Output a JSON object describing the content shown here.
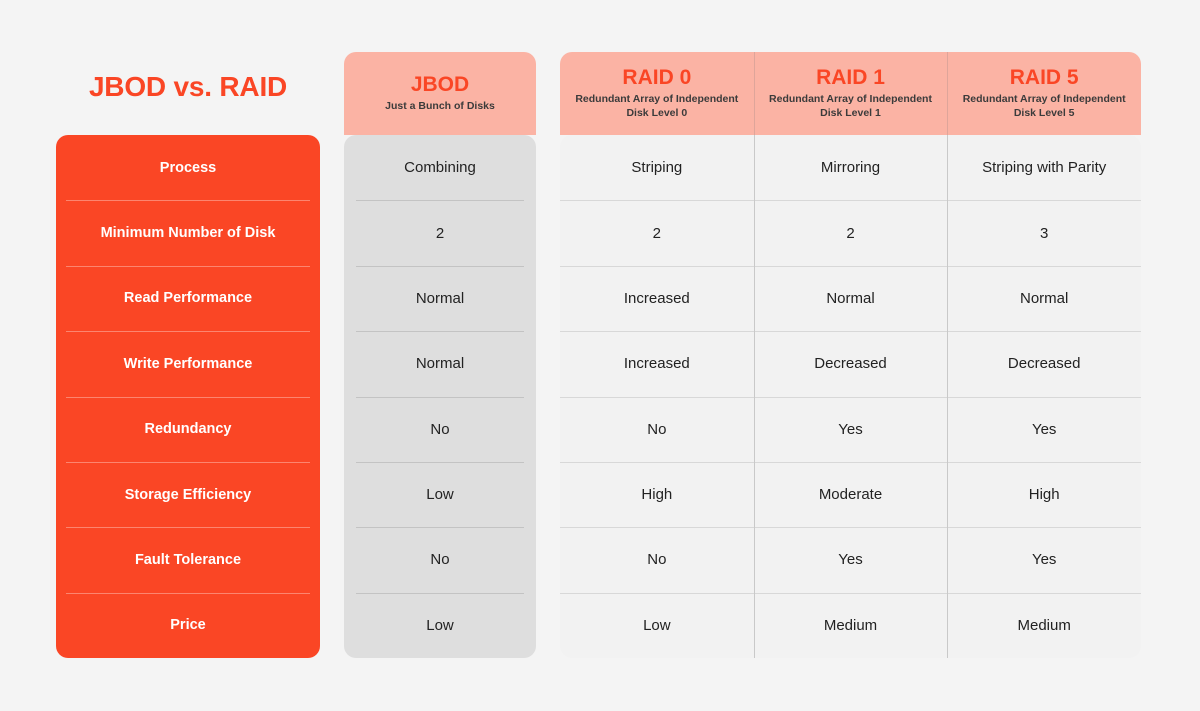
{
  "title": "JBOD vs. RAID",
  "colors": {
    "background": "#f4f4f4",
    "accent_red": "#fa4625",
    "header_pink": "#fbb3a4",
    "jbod_body_gray": "#dedede",
    "raid_body_gray": "#f2f2f2",
    "label_text": "#ffffff",
    "value_text": "#222222",
    "subtitle_text": "#3b3b3b"
  },
  "row_labels": [
    "Process",
    "Minimum Number of Disk",
    "Read Performance",
    "Write Performance",
    "Redundancy",
    "Storage Efficiency",
    "Fault Tolerance",
    "Price"
  ],
  "jbod": {
    "title": "JBOD",
    "subtitle": "Just a Bunch of Disks",
    "values": [
      "Combining",
      "2",
      "Normal",
      "Normal",
      "No",
      "Low",
      "No",
      "Low"
    ]
  },
  "raid": [
    {
      "title": "RAID 0",
      "subtitle": "Redundant Array of Independent Disk Level 0",
      "values": [
        "Striping",
        "2",
        "Increased",
        "Increased",
        "No",
        "High",
        "No",
        "Low"
      ]
    },
    {
      "title": "RAID 1",
      "subtitle": "Redundant Array of Independent Disk Level 1",
      "values": [
        "Mirroring",
        "2",
        "Normal",
        "Decreased",
        "Yes",
        "Moderate",
        "Yes",
        "Medium"
      ]
    },
    {
      "title": "RAID 5",
      "subtitle": "Redundant Array of Independent Disk Level 5",
      "values": [
        "Striping with Parity",
        "3",
        "Normal",
        "Decreased",
        "Yes",
        "High",
        "Yes",
        "Medium"
      ]
    }
  ]
}
